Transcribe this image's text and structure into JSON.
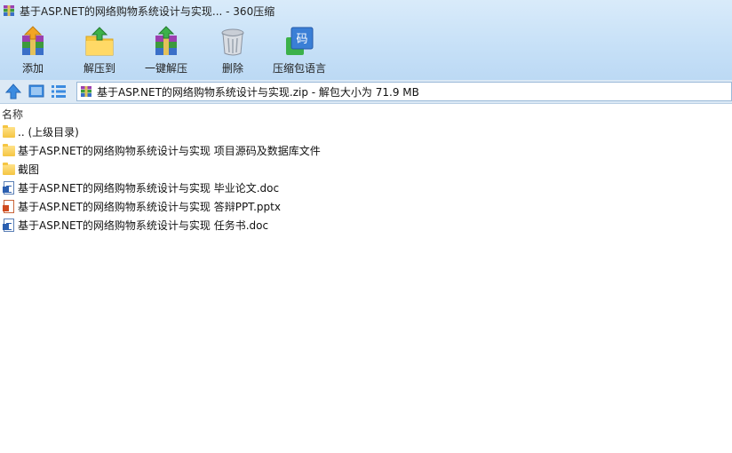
{
  "window": {
    "title": "基于ASP.NET的网络购物系统设计与实现... - 360压缩"
  },
  "toolbar": {
    "items": [
      {
        "label": "添加",
        "icon": "add-archive-icon"
      },
      {
        "label": "解压到",
        "icon": "extract-to-folder-icon"
      },
      {
        "label": "一键解压",
        "icon": "one-click-extract-icon"
      },
      {
        "label": "删除",
        "icon": "trash-bin-icon"
      },
      {
        "label": "压缩包语言",
        "icon": "archive-language-icon"
      }
    ]
  },
  "nav": {
    "up_icon": "up-arrow-icon",
    "view_icon": "thumbnail-view-icon",
    "list_icon": "list-view-icon"
  },
  "address": {
    "text": "基于ASP.NET的网络购物系统设计与实现.zip - 解包大小为 71.9 MB"
  },
  "filelist": {
    "header": "名称",
    "rows": [
      {
        "name": ".. (上级目录)",
        "type": "folder"
      },
      {
        "name": "基于ASP.NET的网络购物系统设计与实现 项目源码及数据库文件",
        "type": "folder"
      },
      {
        "name": "截图",
        "type": "folder"
      },
      {
        "name": "基于ASP.NET的网络购物系统设计与实现 毕业论文.doc",
        "type": "doc"
      },
      {
        "name": "基于ASP.NET的网络购物系统设计与实现 答辩PPT.pptx",
        "type": "ppt"
      },
      {
        "name": "基于ASP.NET的网络购物系统设计与实现 任务书.doc",
        "type": "doc"
      }
    ]
  },
  "colors": {
    "accent": "#3b8be0",
    "band_top": "#d9ebfa",
    "band_bottom": "#bcd9f4"
  }
}
